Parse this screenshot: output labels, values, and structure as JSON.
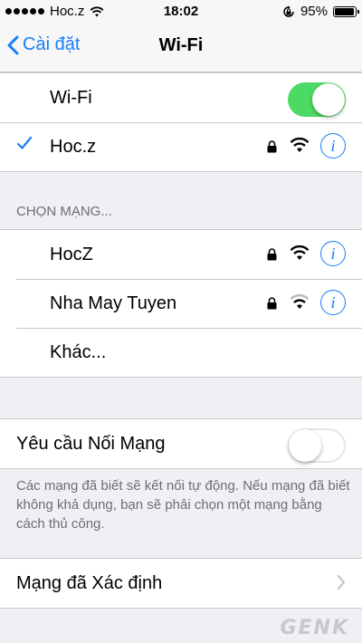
{
  "status_bar": {
    "carrier": "Hoc.z",
    "time": "18:02",
    "battery": "95%",
    "battery_level": 0.95
  },
  "nav": {
    "back_label": "Cài đặt",
    "title": "Wi-Fi"
  },
  "wifi_toggle": {
    "label": "Wi-Fi",
    "state": "on"
  },
  "connected_network": {
    "name": "Hoc.z"
  },
  "choose_network": {
    "header": "CHỌN MẠNG...",
    "networks": [
      {
        "name": "HocZ",
        "secured": true
      },
      {
        "name": "Nha May Tuyen",
        "secured": true
      }
    ],
    "other_label": "Khác..."
  },
  "ask_to_join": {
    "label": "Yêu cầu Nối Mạng",
    "state": "off",
    "note": "Các mạng đã biết sẽ kết nối tự động. Nếu mạng đã biết không khả dụng, bạn sẽ phải chọn một mạng bằng cách thủ công."
  },
  "known_networks": {
    "label": "Mạng đã Xác định"
  },
  "watermark": "GENK",
  "icons": {
    "info": "i",
    "check": "checkmark-icon",
    "lock": "lock-icon",
    "wifi": "wifi-icon",
    "chevron": "chevron-right-icon",
    "back": "chevron-left-icon"
  },
  "colors": {
    "accent": "#157efb",
    "toggle_on": "#4cd964",
    "background": "#efeff4",
    "section_text": "#6d6d72"
  }
}
